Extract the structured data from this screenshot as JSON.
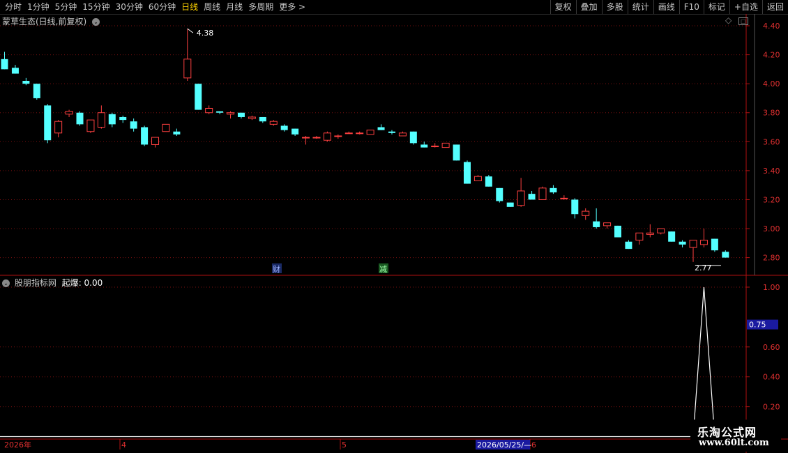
{
  "toolbar": {
    "periods": [
      "分时",
      "1分钟",
      "5分钟",
      "15分钟",
      "30分钟",
      "60分钟",
      "日线",
      "周线",
      "月线",
      "多周期",
      "更多 >"
    ],
    "active_period": "日线",
    "right_buttons": [
      "复权",
      "叠加",
      "多股",
      "统计",
      "画线",
      "F10",
      "标记",
      "+自选",
      "返回"
    ]
  },
  "main_panel": {
    "title": "蒙草生态(日线,前复权)",
    "high_label": "4.38",
    "low_label": "2.77",
    "markers": [
      "财",
      "减"
    ]
  },
  "indicator_panel": {
    "title": "股朋指标网",
    "indicator_name": "起爆",
    "indicator_value": "0.00",
    "cursor_value": "0.75"
  },
  "x_axis": {
    "year_label": "2026年",
    "month_labels": [
      "4",
      "5",
      "6"
    ],
    "cursor_date": "2026/05/25/—"
  },
  "watermark": {
    "line1": "乐淘公式网",
    "line2": "www.60lt.com"
  },
  "colors": {
    "up": "#ff4040",
    "down": "#54ffff",
    "grid": "#7a1010",
    "axis": "#b01010",
    "line": "#ffffff"
  },
  "chart_data": [
    {
      "type": "candlestick",
      "title": "蒙草生态(日线,前复权)",
      "y_ticks": [
        "4.40",
        "4.20",
        "4.00",
        "3.80",
        "3.60",
        "3.40",
        "3.20",
        "3.00",
        "2.80"
      ],
      "ylim": [
        2.73,
        4.43
      ],
      "ohlc": [
        [
          4.17,
          4.22,
          4.1,
          4.1
        ],
        [
          4.11,
          4.13,
          4.07,
          4.07
        ],
        [
          4.02,
          4.04,
          3.99,
          4.0
        ],
        [
          4.0,
          4.0,
          3.89,
          3.9
        ],
        [
          3.85,
          3.86,
          3.59,
          3.61
        ],
        [
          3.66,
          3.75,
          3.63,
          3.74
        ],
        [
          3.79,
          3.82,
          3.77,
          3.81
        ],
        [
          3.8,
          3.81,
          3.71,
          3.72
        ],
        [
          3.67,
          3.75,
          3.66,
          3.75
        ],
        [
          3.7,
          3.85,
          3.69,
          3.8
        ],
        [
          3.79,
          3.8,
          3.7,
          3.72
        ],
        [
          3.77,
          3.78,
          3.73,
          3.75
        ],
        [
          3.74,
          3.76,
          3.67,
          3.69
        ],
        [
          3.7,
          3.71,
          3.57,
          3.58
        ],
        [
          3.58,
          3.63,
          3.56,
          3.63
        ],
        [
          3.67,
          3.72,
          3.67,
          3.72
        ],
        [
          3.67,
          3.69,
          3.64,
          3.65
        ],
        [
          4.04,
          4.38,
          4.02,
          4.17
        ],
        [
          4.0,
          4.0,
          3.82,
          3.82
        ],
        [
          3.8,
          3.85,
          3.79,
          3.83
        ],
        [
          3.81,
          3.81,
          3.79,
          3.8
        ],
        [
          3.79,
          3.81,
          3.76,
          3.8
        ],
        [
          3.8,
          3.8,
          3.76,
          3.77
        ],
        [
          3.76,
          3.78,
          3.75,
          3.77
        ],
        [
          3.77,
          3.77,
          3.73,
          3.74
        ],
        [
          3.72,
          3.75,
          3.71,
          3.74
        ],
        [
          3.71,
          3.72,
          3.67,
          3.68
        ],
        [
          3.69,
          3.69,
          3.64,
          3.65
        ],
        [
          3.63,
          3.64,
          3.58,
          3.63
        ],
        [
          3.63,
          3.64,
          3.62,
          3.63
        ],
        [
          3.61,
          3.67,
          3.6,
          3.66
        ],
        [
          3.64,
          3.65,
          3.62,
          3.64
        ],
        [
          3.66,
          3.67,
          3.66,
          3.66
        ],
        [
          3.66,
          3.67,
          3.65,
          3.66
        ],
        [
          3.65,
          3.68,
          3.65,
          3.68
        ],
        [
          3.7,
          3.72,
          3.68,
          3.68
        ],
        [
          3.67,
          3.68,
          3.65,
          3.66
        ],
        [
          3.64,
          3.67,
          3.64,
          3.66
        ],
        [
          3.67,
          3.67,
          3.58,
          3.59
        ],
        [
          3.58,
          3.6,
          3.56,
          3.56
        ],
        [
          3.57,
          3.59,
          3.56,
          3.57
        ],
        [
          3.56,
          3.59,
          3.56,
          3.59
        ],
        [
          3.58,
          3.58,
          3.47,
          3.47
        ],
        [
          3.46,
          3.47,
          3.31,
          3.31
        ],
        [
          3.33,
          3.37,
          3.33,
          3.36
        ],
        [
          3.36,
          3.37,
          3.29,
          3.29
        ],
        [
          3.28,
          3.28,
          3.18,
          3.19
        ],
        [
          3.18,
          3.18,
          3.15,
          3.15
        ],
        [
          3.16,
          3.35,
          3.15,
          3.26
        ],
        [
          3.24,
          3.26,
          3.2,
          3.2
        ],
        [
          3.2,
          3.29,
          3.2,
          3.28
        ],
        [
          3.28,
          3.3,
          3.24,
          3.25
        ],
        [
          3.21,
          3.23,
          3.2,
          3.21
        ],
        [
          3.2,
          3.21,
          3.07,
          3.1
        ],
        [
          3.09,
          3.14,
          3.06,
          3.12
        ],
        [
          3.05,
          3.14,
          3.0,
          3.01
        ],
        [
          3.02,
          3.04,
          3.0,
          3.04
        ],
        [
          3.02,
          3.02,
          2.94,
          2.94
        ],
        [
          2.91,
          2.92,
          2.86,
          2.86
        ],
        [
          2.92,
          2.97,
          2.89,
          2.97
        ],
        [
          2.96,
          3.03,
          2.94,
          2.97
        ],
        [
          2.97,
          3.0,
          2.96,
          3.0
        ],
        [
          2.98,
          2.98,
          2.91,
          2.91
        ],
        [
          2.91,
          2.92,
          2.87,
          2.89
        ],
        [
          2.87,
          2.92,
          2.77,
          2.92
        ],
        [
          2.89,
          3.0,
          2.87,
          2.92
        ],
        [
          2.93,
          2.93,
          2.84,
          2.85
        ],
        [
          2.84,
          2.85,
          2.8,
          2.8
        ]
      ]
    },
    {
      "type": "line",
      "title": "股朋指标网",
      "series": [
        {
          "name": "起爆",
          "index": [
            0,
            63,
            64,
            65,
            66
          ],
          "values": [
            0,
            0,
            0,
            1,
            0
          ]
        }
      ],
      "y_ticks": [
        "1.00",
        "0.60",
        "0.40",
        "0.20"
      ],
      "ylim": [
        -0.2,
        1.05
      ]
    }
  ]
}
